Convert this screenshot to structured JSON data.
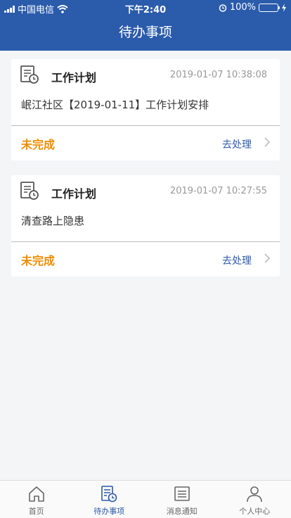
{
  "status_bar": {
    "carrier": "中国电信",
    "time": "下午2:40",
    "battery": "100%"
  },
  "header": {
    "title": "待办事项"
  },
  "tasks": [
    {
      "type": "工作计划",
      "time": "2019-01-07 10:38:08",
      "content": "岷江社区【2019-01-11】工作计划安排",
      "status": "未完成",
      "action": "去处理"
    },
    {
      "type": "工作计划",
      "time": "2019-01-07 10:27:55",
      "content": "清查路上隐患",
      "status": "未完成",
      "action": "去处理"
    }
  ],
  "tabbar": [
    {
      "label": "首页",
      "icon": "home-icon"
    },
    {
      "label": "待办事项",
      "icon": "todo-icon",
      "active": true
    },
    {
      "label": "消息通知",
      "icon": "message-icon"
    },
    {
      "label": "个人中心",
      "icon": "person-icon"
    }
  ],
  "colors": {
    "primary": "#2b5bab",
    "warning": "#f08c00",
    "background": "#f4f5f7"
  }
}
